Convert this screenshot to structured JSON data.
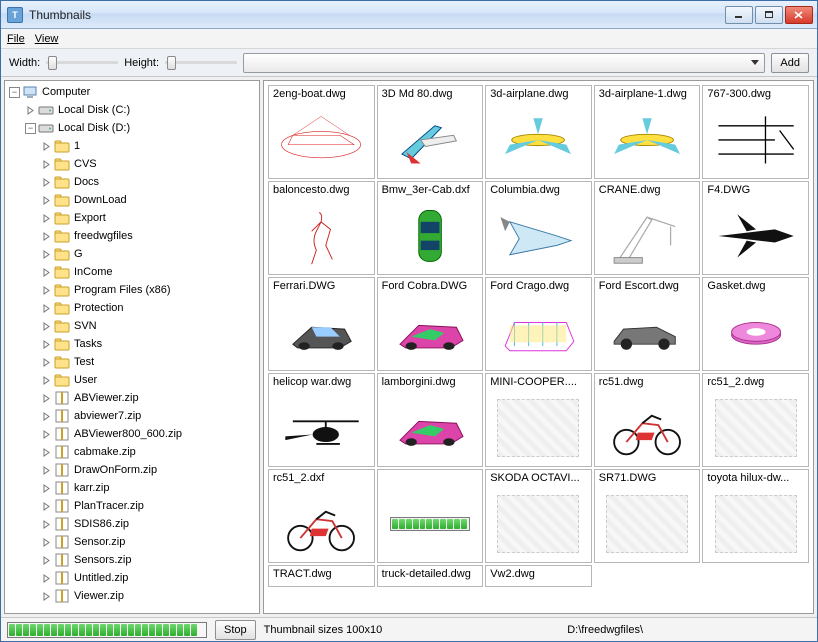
{
  "window": {
    "title": "Thumbnails"
  },
  "menu": {
    "file": "File",
    "view": "View"
  },
  "toolbar": {
    "width_label": "Width:",
    "height_label": "Height:",
    "add_btn": "Add"
  },
  "tree": {
    "root": {
      "label": "Computer",
      "expanded": true
    },
    "drives": [
      {
        "label": "Local Disk (C:)",
        "expanded": false,
        "has_children": true
      },
      {
        "label": "Local Disk (D:)",
        "expanded": true,
        "has_children": true
      }
    ],
    "d_children": [
      {
        "type": "folder",
        "label": "1",
        "has_children": true
      },
      {
        "type": "folder",
        "label": "CVS",
        "has_children": true
      },
      {
        "type": "folder",
        "label": "Docs",
        "has_children": true
      },
      {
        "type": "folder",
        "label": "DownLoad",
        "has_children": true
      },
      {
        "type": "folder",
        "label": "Export",
        "has_children": true
      },
      {
        "type": "folder",
        "label": "freedwgfiles",
        "has_children": true,
        "icon": "folder-alt"
      },
      {
        "type": "folder",
        "label": "G",
        "has_children": true
      },
      {
        "type": "folder",
        "label": "InCome",
        "has_children": true,
        "icon": "folder-alt"
      },
      {
        "type": "folder",
        "label": "Program Files (x86)",
        "has_children": true
      },
      {
        "type": "folder",
        "label": "Protection",
        "has_children": true
      },
      {
        "type": "folder",
        "label": "SVN",
        "has_children": true
      },
      {
        "type": "folder",
        "label": "Tasks",
        "has_children": true
      },
      {
        "type": "folder",
        "label": "Test",
        "has_children": true
      },
      {
        "type": "folder",
        "label": "User",
        "has_children": true
      },
      {
        "type": "zip",
        "label": "ABViewer.zip",
        "has_children": true
      },
      {
        "type": "zip",
        "label": "abviewer7.zip",
        "has_children": true
      },
      {
        "type": "zip",
        "label": "ABViewer800_600.zip",
        "has_children": true
      },
      {
        "type": "zip",
        "label": "cabmake.zip",
        "has_children": true
      },
      {
        "type": "zip",
        "label": "DrawOnForm.zip",
        "has_children": true
      },
      {
        "type": "zip",
        "label": "karr.zip",
        "has_children": true
      },
      {
        "type": "zip",
        "label": "PlanTracer.zip",
        "has_children": true
      },
      {
        "type": "zip",
        "label": "SDIS86.zip",
        "has_children": true
      },
      {
        "type": "zip",
        "label": "Sensor.zip",
        "has_children": true
      },
      {
        "type": "zip",
        "label": "Sensors.zip",
        "has_children": true
      },
      {
        "type": "zip",
        "label": "Untitled.zip",
        "has_children": true
      },
      {
        "type": "zip",
        "label": "Viewer.zip",
        "has_children": true
      }
    ]
  },
  "thumbnails": [
    {
      "name": "2eng-boat.dwg",
      "preview": "boat"
    },
    {
      "name": "3D Md 80.dwg",
      "preview": "plane1"
    },
    {
      "name": "3d-airplane.dwg",
      "preview": "plane2"
    },
    {
      "name": "3d-airplane-1.dwg",
      "preview": "plane2"
    },
    {
      "name": "767-300.dwg",
      "preview": "lines"
    },
    {
      "name": "baloncesto.dwg",
      "preview": "figure"
    },
    {
      "name": "Bmw_3er-Cab.dxf",
      "preview": "car-top"
    },
    {
      "name": "Columbia.dwg",
      "preview": "shuttle"
    },
    {
      "name": "CRANE.dwg",
      "preview": "crane"
    },
    {
      "name": "F4.DWG",
      "preview": "jet"
    },
    {
      "name": "Ferrari.DWG",
      "preview": "car3d1"
    },
    {
      "name": "Ford Cobra.DWG",
      "preview": "car3d2"
    },
    {
      "name": "Ford Crago.dwg",
      "preview": "bus"
    },
    {
      "name": "Ford Escort.dwg",
      "preview": "car-side"
    },
    {
      "name": "Gasket.dwg",
      "preview": "gasket"
    },
    {
      "name": "helicop war.dwg",
      "preview": "helicopter"
    },
    {
      "name": "lamborgini.dwg",
      "preview": "car3d2"
    },
    {
      "name": "MINI-COOPER....",
      "preview": "blank"
    },
    {
      "name": "rc51.dwg",
      "preview": "moto"
    },
    {
      "name": "rc51_2.dwg",
      "preview": "blank"
    },
    {
      "name": "rc51_2.dxf",
      "preview": "moto"
    },
    {
      "name": "",
      "preview": "loading"
    },
    {
      "name": "SKODA OCTAVI...",
      "preview": "blank"
    },
    {
      "name": "SR71.DWG",
      "preview": "blank"
    },
    {
      "name": "toyota hilux-dw...",
      "preview": "blank"
    },
    {
      "name": "TRACT.dwg",
      "preview": null,
      "short": true
    },
    {
      "name": "truck-detailed.dwg",
      "preview": null,
      "short": true
    },
    {
      "name": "Vw2.dwg",
      "preview": null,
      "short": true
    }
  ],
  "status": {
    "stop_btn": "Stop",
    "size_label": "Thumbnail sizes 100x10",
    "path": "D:\\freedwgfiles\\"
  }
}
